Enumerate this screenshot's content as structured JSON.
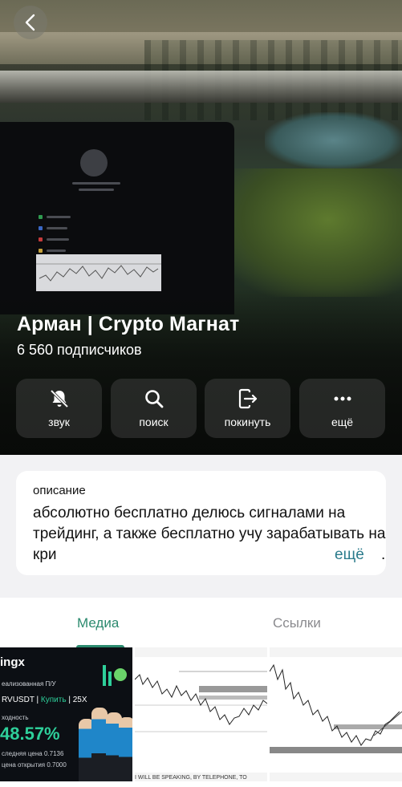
{
  "header": {
    "title": "Арман | Crypto Магнат",
    "subscribers": "6 560 подписчиков"
  },
  "actions": [
    {
      "label": "звук",
      "icon": "bell-slash-icon"
    },
    {
      "label": "поиск",
      "icon": "search-icon"
    },
    {
      "label": "покинуть",
      "icon": "leave-icon"
    },
    {
      "label": "ещё",
      "icon": "more-dots-icon"
    }
  ],
  "description": {
    "label": "описание",
    "text": "абсолютно бесплатно делюсь сигналами на трейдинг, а также бесплатно учу зарабатывать на кри",
    "more": "ещё",
    "end": "."
  },
  "tabs": {
    "media": "Медиа",
    "links": "Ссылки"
  },
  "media_thumb": {
    "logo": "ingx",
    "line1": "еализованная П/У",
    "pair": "RVUSDT",
    "buy": "Купить",
    "leverage": "25X",
    "line2": "ходность",
    "pct": "48.57%",
    "last_price": "следняя цена  0.7136",
    "open_price": "цена открытия  0.7000",
    "caption": "I WILL BE SPEAKING, BY TELEPHONE, TO"
  },
  "colors": {
    "accent": "#2b8a6e",
    "link": "#2b7b8c",
    "profit": "#2ecf9a"
  }
}
